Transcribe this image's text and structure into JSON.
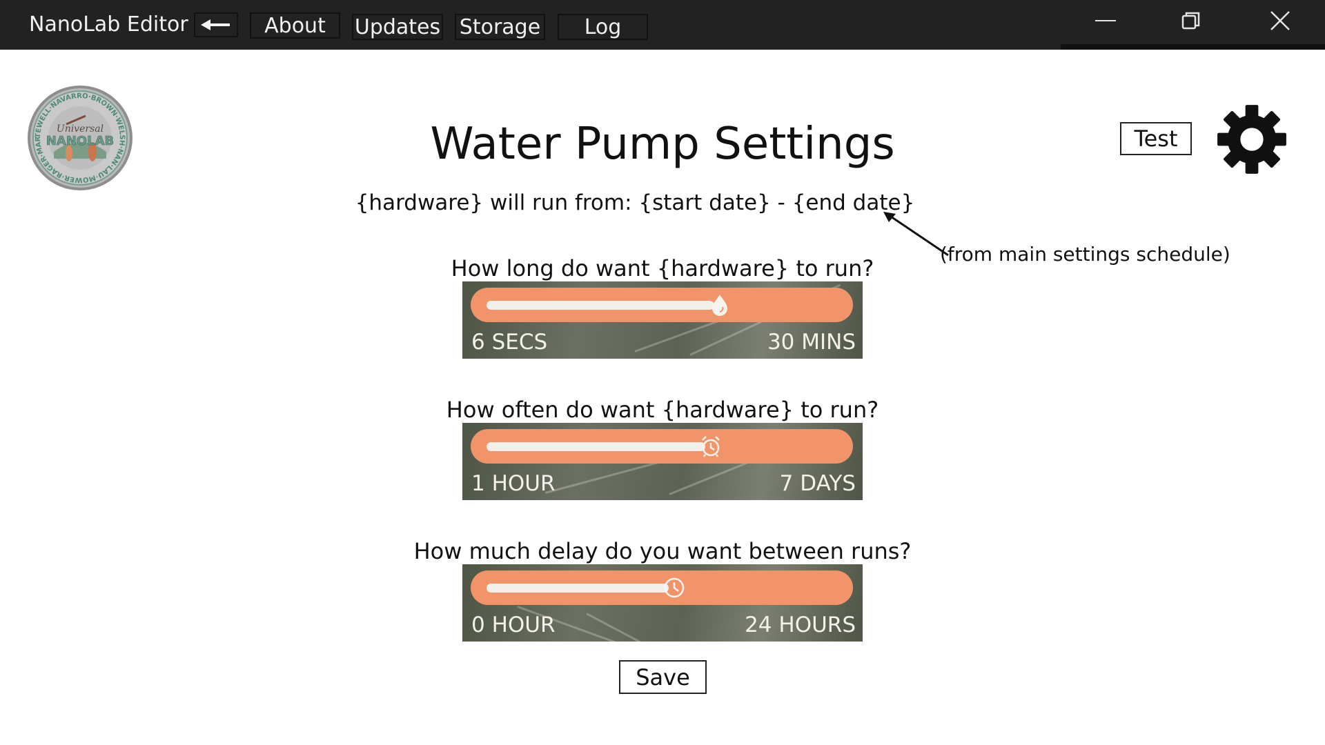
{
  "app": {
    "title": "NanoLab Editor",
    "nav": {
      "back_icon": "left-arrow-icon",
      "about": "About",
      "updates": "Updates",
      "storage": "Storage",
      "log": "Log"
    },
    "window_controls": [
      "minimize-icon",
      "restore-icon",
      "close-icon"
    ]
  },
  "logo": {
    "ring_text": "TEWELL·NAVARRO·BROWN·WELSH·NAN·LAU·MOWER·RAGER·MARCUSON·WINKLER·",
    "center_top": "Universal",
    "center_main": "NANOLAB"
  },
  "header": {
    "title": "Water Pump Settings",
    "schedule": "{hardware} will run from: {start date} - {end date}",
    "note": "(from main settings schedule)",
    "test_label": "Test",
    "settings_icon": "gear-icon"
  },
  "sliders": [
    {
      "question": "How long do want {hardware} to run?",
      "min_label": "6 SECS",
      "max_label": "30 MINS",
      "value_fraction": 0.75,
      "icon": "water-drop-icon"
    },
    {
      "question": "How often do want {hardware} to run?",
      "min_label": "1 HOUR",
      "max_label": "7 DAYS",
      "value_fraction": 0.72,
      "icon": "alarm-clock-icon"
    },
    {
      "question": "How much delay do you want between runs?",
      "min_label": "0 HOUR",
      "max_label": "24 HOURS",
      "value_fraction": 0.6,
      "icon": "clock-icon"
    }
  ],
  "save_label": "Save",
  "colors": {
    "titlebar": "#222222",
    "slider_track": "#f2946a",
    "slider_fill": "#f3efea",
    "slider_background": "#5d6354"
  }
}
